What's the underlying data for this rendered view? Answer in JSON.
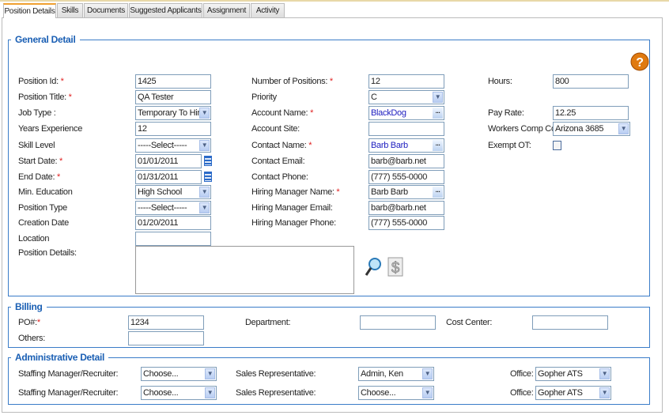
{
  "tabs": [
    "Position Details",
    "Skills",
    "Documents",
    "Suggested Applicants",
    "Assignment",
    "Activity"
  ],
  "general": {
    "legend": "General Detail",
    "col1": [
      {
        "label": "Position Id:",
        "req": true,
        "value": "1425",
        "type": "text"
      },
      {
        "label": "Position Title:",
        "req": true,
        "value": "QA Tester",
        "type": "text"
      },
      {
        "label": "Job Type :",
        "req": false,
        "value": "Temporary To Hire",
        "type": "select"
      },
      {
        "label": "Years Experience",
        "req": false,
        "value": "12",
        "type": "text"
      },
      {
        "label": "Skill Level",
        "req": false,
        "value": "-----Select-----",
        "type": "select"
      },
      {
        "label": "Start Date:",
        "req": true,
        "value": "01/01/2011",
        "type": "date"
      },
      {
        "label": "End Date:",
        "req": true,
        "value": "01/31/2011",
        "type": "date"
      },
      {
        "label": "Min. Education",
        "req": false,
        "value": "High School",
        "type": "select"
      },
      {
        "label": "Position Type",
        "req": false,
        "value": "-----Select-----",
        "type": "select"
      },
      {
        "label": "Creation Date",
        "req": false,
        "value": "01/20/2011",
        "type": "text"
      },
      {
        "label": "Location",
        "req": false,
        "value": "",
        "type": "text"
      },
      {
        "label": "Position Details:",
        "req": false,
        "value": "",
        "type": "textarea"
      }
    ],
    "col2": [
      {
        "label": "Number of Positions:",
        "req": true,
        "value": "12",
        "type": "text"
      },
      {
        "label": "Priority",
        "req": false,
        "value": "C",
        "type": "select"
      },
      {
        "label": "Account Name:",
        "req": true,
        "value": "BlackDog",
        "type": "lookup-blue"
      },
      {
        "label": "Account Site:",
        "req": false,
        "value": "",
        "type": "text"
      },
      {
        "label": "Contact Name:",
        "req": true,
        "value": "Barb Barb",
        "type": "lookup-blue"
      },
      {
        "label": "Contact Email:",
        "req": false,
        "value": "barb@barb.net",
        "type": "text"
      },
      {
        "label": "Contact Phone:",
        "req": false,
        "value": "(777) 555-0000",
        "type": "text"
      },
      {
        "label": "Hiring Manager Name:",
        "req": true,
        "value": "Barb Barb",
        "type": "lookup"
      },
      {
        "label": "Hiring Manager Email:",
        "req": false,
        "value": "barb@barb.net",
        "type": "text"
      },
      {
        "label": "Hiring Manager Phone:",
        "req": false,
        "value": "(777) 555-0000",
        "type": "text"
      }
    ],
    "col3": [
      {
        "row": 0,
        "label": "Hours:",
        "value": "800",
        "type": "text"
      },
      {
        "row": 2,
        "label": "Pay Rate:",
        "value": "12.25",
        "type": "text"
      },
      {
        "row": 3,
        "label": "Workers Comp Code:",
        "value": "Arizona 3685",
        "type": "select"
      },
      {
        "row": 4,
        "label": "Exempt OT:",
        "value": "",
        "type": "checkbox"
      }
    ]
  },
  "billing": {
    "legend": "Billing",
    "po_label": "PO#:",
    "po_value": "1234",
    "department_label": "Department:",
    "department_value": "",
    "cost_center_label": "Cost Center:",
    "cost_center_value": "",
    "others_label": "Others:",
    "others_value": ""
  },
  "admin": {
    "legend": "Administrative Detail",
    "rows": [
      {
        "staff_label": "Staffing Manager/Recruiter:",
        "staff_value": "Choose...",
        "sales_label": "Sales Representative:",
        "sales_value": "Admin, Ken",
        "office_label": "Office:",
        "office_value": "Gopher ATS"
      },
      {
        "staff_label": "Staffing Manager/Recruiter:",
        "staff_value": "Choose...",
        "sales_label": "Sales Representative:",
        "sales_value": "Choose...",
        "office_label": "Office:",
        "office_value": "Gopher ATS"
      }
    ]
  }
}
